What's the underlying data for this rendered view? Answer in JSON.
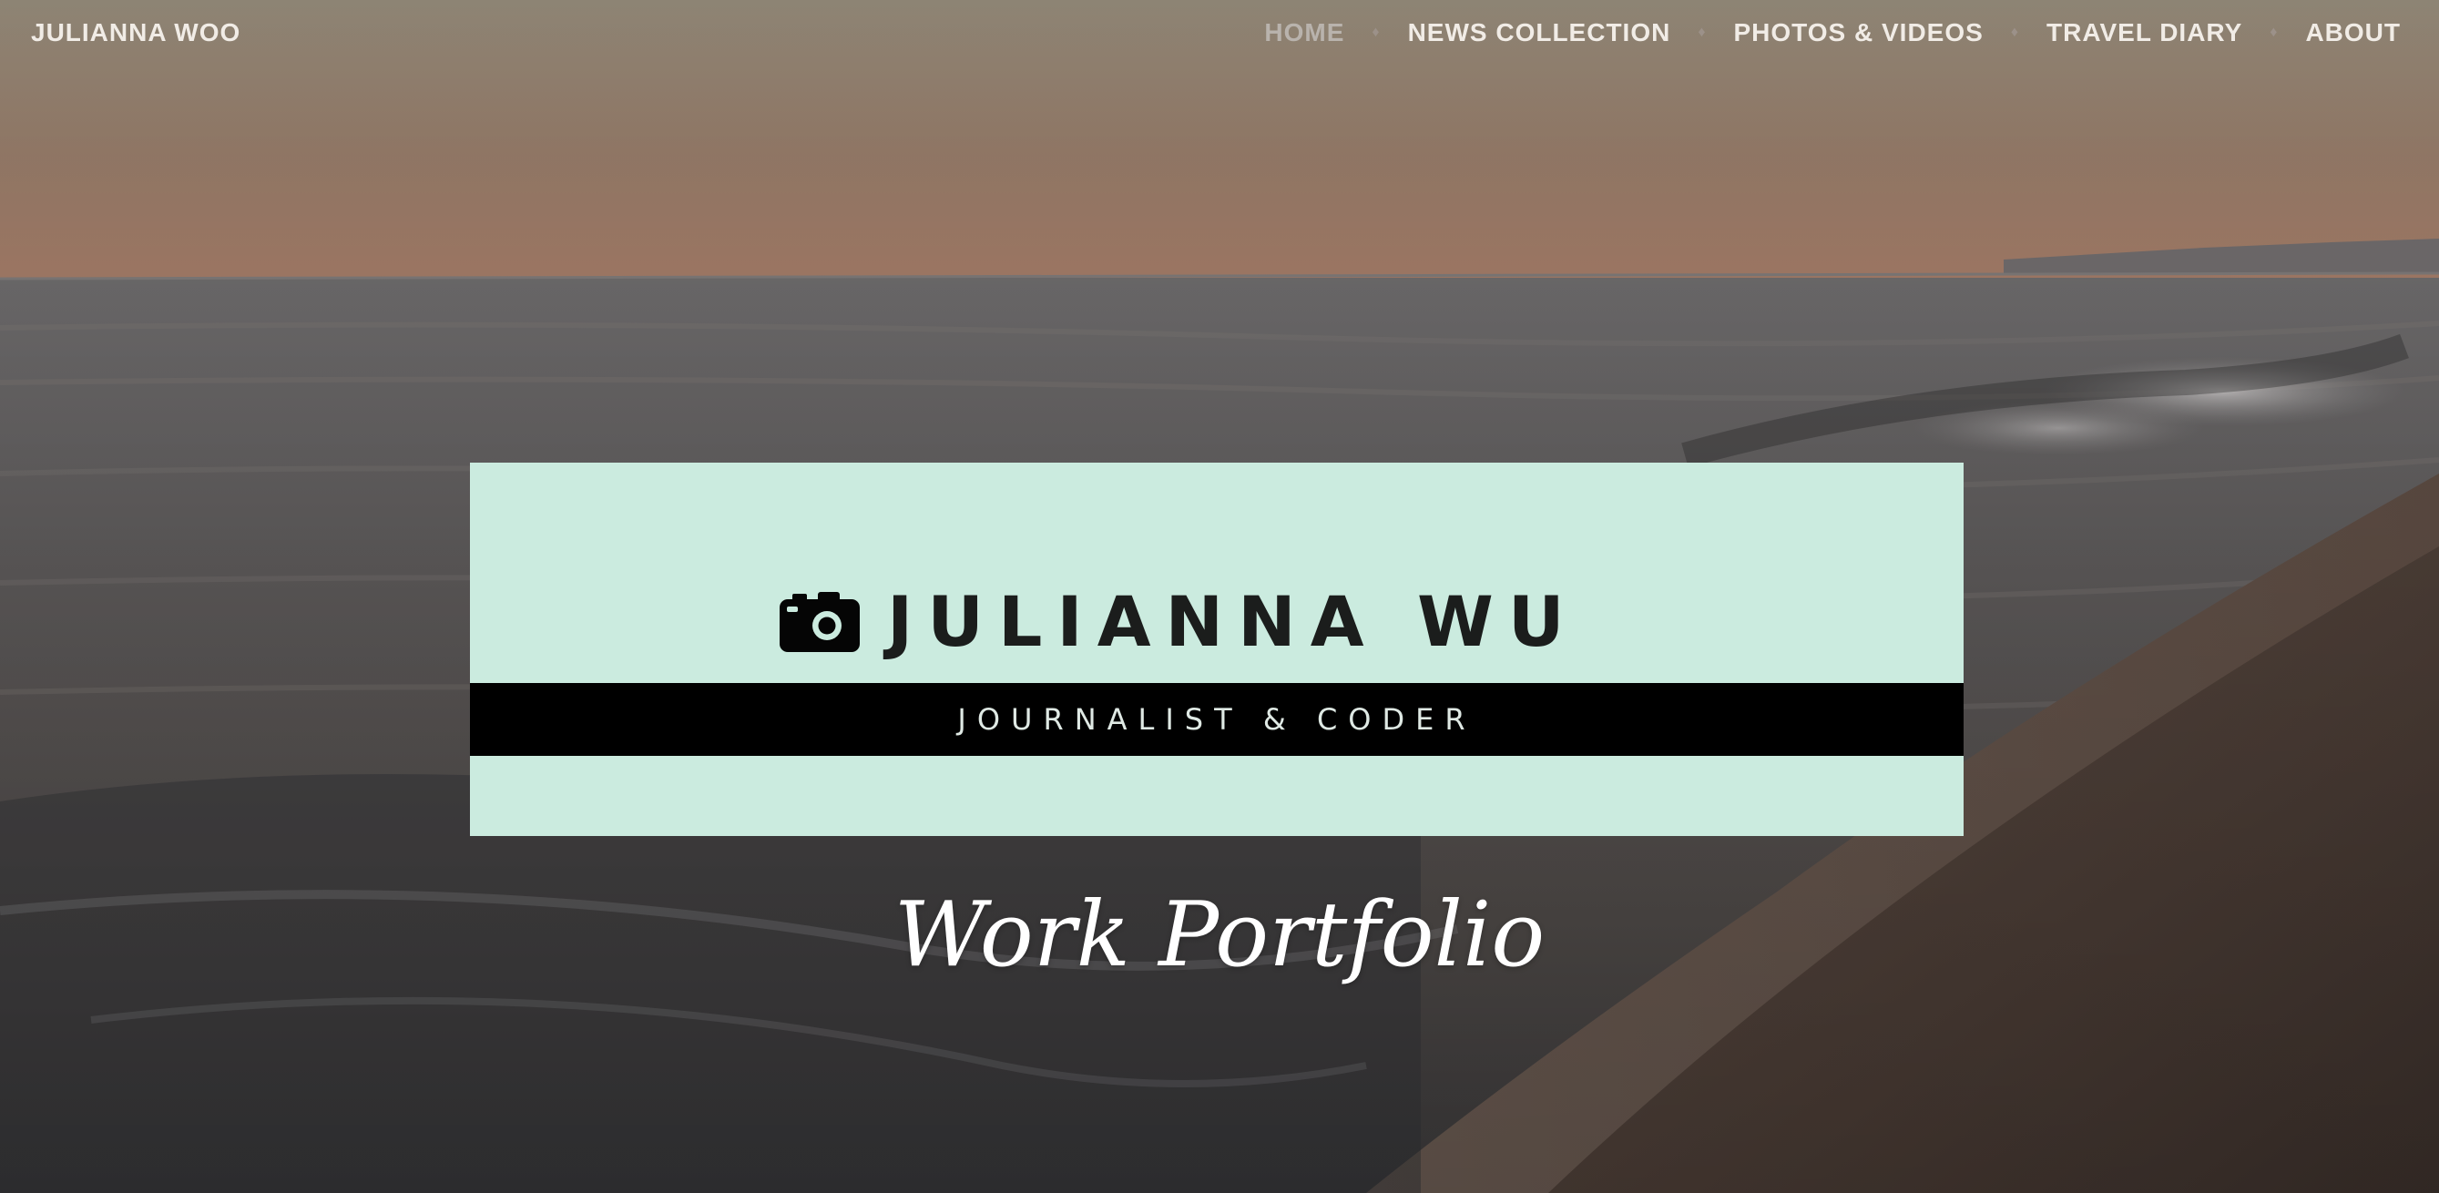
{
  "site": {
    "title": "JULIANNA WOO"
  },
  "nav": {
    "separator": "♦",
    "items": [
      {
        "label": "HOME",
        "active": true
      },
      {
        "label": "NEWS COLLECTION",
        "active": false
      },
      {
        "label": "PHOTOS & VIDEOS",
        "active": false
      },
      {
        "label": "TRAVEL DIARY",
        "active": false
      },
      {
        "label": "ABOUT",
        "active": false
      }
    ]
  },
  "banner": {
    "name": "JULIANNA WU",
    "tagline": "JOURNALIST & CODER",
    "icon": "camera-icon",
    "background_color": "#cbebdf",
    "strip_color": "#000000"
  },
  "hero": {
    "title": "Work Portfolio"
  }
}
